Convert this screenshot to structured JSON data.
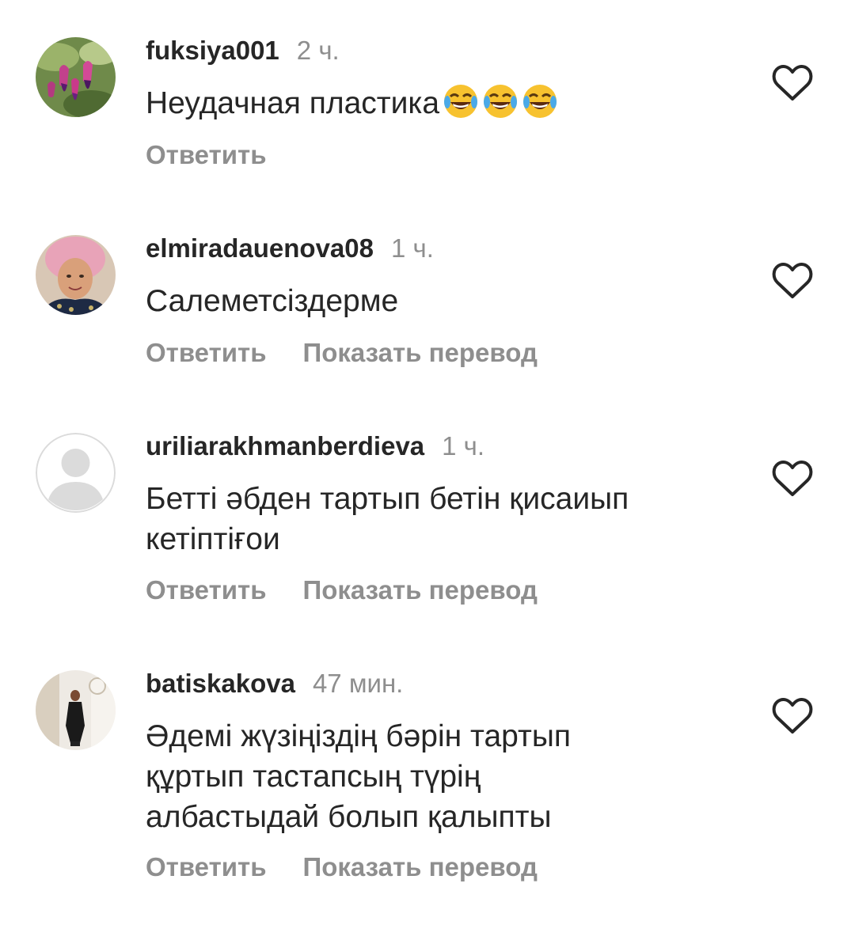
{
  "comments": [
    {
      "username": "fuksiya001",
      "time": "2 ч.",
      "text": "Неудачная пластика",
      "emoji_name": "face-with-tears-of-joy-icon",
      "emoji_count": 3,
      "reply_label": "Ответить",
      "translate_label": null
    },
    {
      "username": "elmiradauenova08",
      "time": "1 ч.",
      "text": "Салеметсіздерме",
      "reply_label": "Ответить",
      "translate_label": "Показать перевод"
    },
    {
      "username": "uriliarakhmanberdieva",
      "time": "1 ч.",
      "text_lines": [
        "Бетті әбден тартып бетін қисаиып",
        "кетіптіғои"
      ],
      "reply_label": "Ответить",
      "translate_label": "Показать перевод"
    },
    {
      "username": "batiskakova",
      "time": "47 мин.",
      "text_lines": [
        "Әдемі жүзіңіздің бәрін тартып",
        "құртып тастапсың түрің",
        "албастыдай болып қалыпты"
      ],
      "reply_label": "Ответить",
      "translate_label": "Показать перевод"
    }
  ],
  "icons": {
    "like": "heart-outline-icon",
    "default_avatar": "default-avatar-icon"
  },
  "colors": {
    "text": "#262626",
    "secondary": "#8e8e8e",
    "background": "#ffffff"
  }
}
